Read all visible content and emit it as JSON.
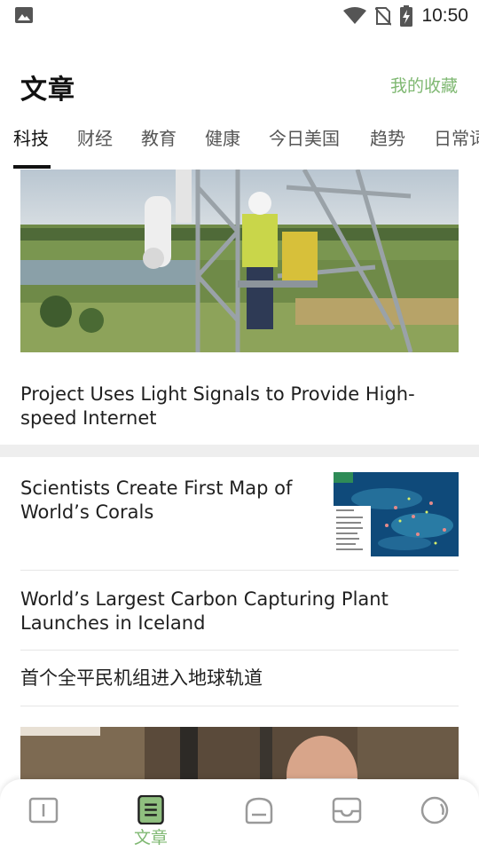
{
  "status_bar": {
    "time": "10:50",
    "icons": [
      "image-notification-icon",
      "wifi-icon",
      "no-sim-icon",
      "battery-charging-icon"
    ]
  },
  "header": {
    "title": "文章",
    "favorites_label": "我的收藏"
  },
  "tabs": [
    {
      "label": "科技",
      "active": true
    },
    {
      "label": "财经",
      "active": false
    },
    {
      "label": "教育",
      "active": false
    },
    {
      "label": "健康",
      "active": false
    },
    {
      "label": "今日美国",
      "active": false
    },
    {
      "label": "趋势",
      "active": false
    },
    {
      "label": "日常词",
      "active": false
    }
  ],
  "feed": {
    "hero": {
      "title": "Project Uses Light Signals to Provide High-speed Internet"
    },
    "articles": [
      {
        "title": "Scientists Create First Map of World’s Corals",
        "thumbnail": "coral-map-thumbnail"
      },
      {
        "title": "World’s Largest Carbon Capturing Plant Launches in Iceland"
      },
      {
        "title": "首个全平民机组进入地球轨道"
      }
    ]
  },
  "bottom_nav": {
    "items": [
      {
        "icon": "book-icon",
        "label": ""
      },
      {
        "icon": "article-icon",
        "label": "文章",
        "active": true
      },
      {
        "icon": "home-icon",
        "label": ""
      },
      {
        "icon": "inbox-icon",
        "label": ""
      },
      {
        "icon": "search-icon",
        "label": ""
      }
    ]
  },
  "colors": {
    "accent": "#7fb872",
    "text": "#1f1f1f",
    "divider": "#eeeeee"
  }
}
